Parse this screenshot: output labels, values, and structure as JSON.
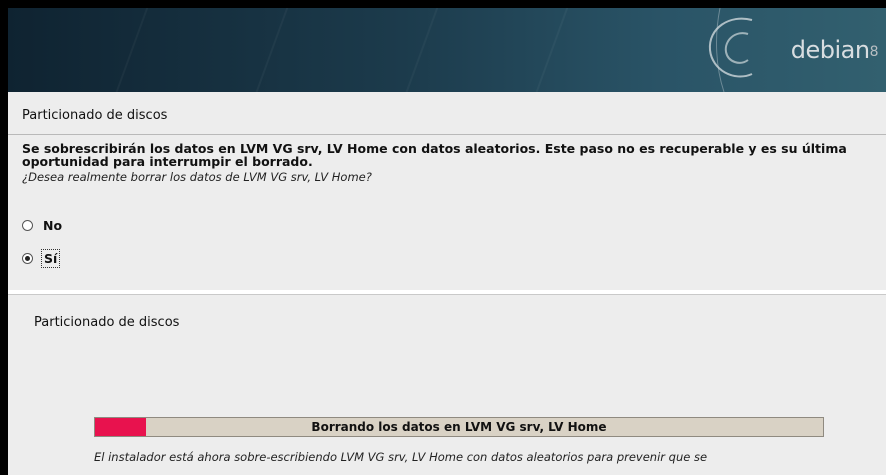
{
  "banner": {
    "logo_text": "debian",
    "logo_version": "8"
  },
  "upper_dialog": {
    "title": "Particionado de discos",
    "question": "Se sobrescribirán los datos en LVM VG srv, LV Home con datos aleatorios. Este paso no es recuperable y es su última oportunidad para interrumpir el borrado.",
    "prompt": "¿Desea realmente borrar los datos de LVM VG srv, LV Home?",
    "options": [
      {
        "label": "No",
        "selected": false
      },
      {
        "label": "Sí",
        "selected": true
      }
    ]
  },
  "lower_dialog": {
    "title": "Particionado de discos",
    "progress_label": "Borrando los datos en LVM VG srv, LV Home",
    "progress_fraction": 0.07,
    "detail": "El instalador está ahora sobre-escribiendo LVM VG srv, LV Home con datos aleatorios para prevenir que se"
  },
  "colors": {
    "progress_fill": "#e8124e",
    "progress_track": "#d9d2c5",
    "banner": "#1c3b4c"
  }
}
